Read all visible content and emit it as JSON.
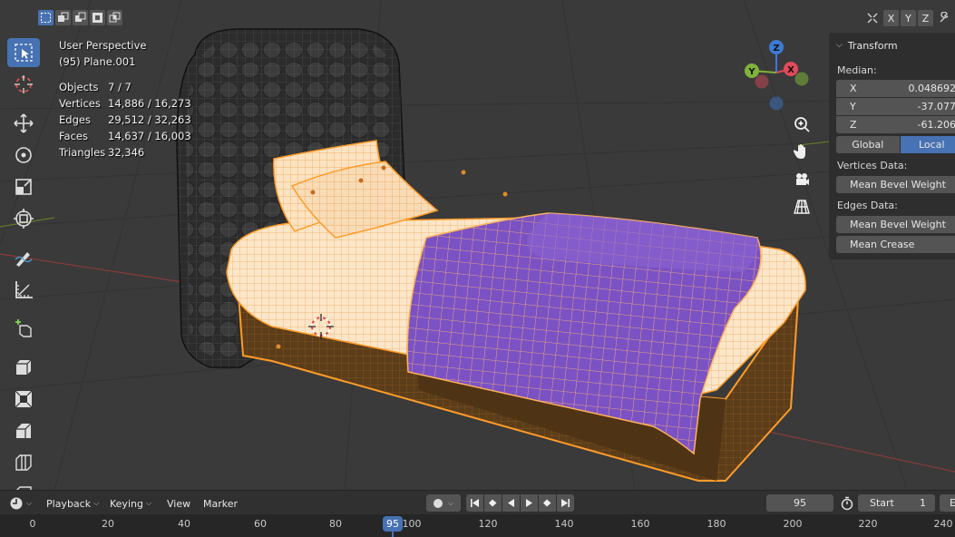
{
  "overlay": {
    "view_name": "User Perspective",
    "object_name": "(95) Plane.001",
    "stats": [
      {
        "label": "Objects",
        "value": "7 / 7"
      },
      {
        "label": "Vertices",
        "value": "14,886 / 16,273"
      },
      {
        "label": "Edges",
        "value": "29,512 / 32,263"
      },
      {
        "label": "Faces",
        "value": "14,637 / 16,003"
      },
      {
        "label": "Triangles",
        "value": "32,346"
      }
    ]
  },
  "header": {
    "mirror_axes": [
      "X",
      "Y",
      "Z"
    ]
  },
  "gizmo": {
    "axes": {
      "x": "X",
      "y": "Y",
      "z": "Z"
    },
    "colors": {
      "x": "#e04a5a",
      "y": "#7fb339",
      "z": "#3d7ad6"
    }
  },
  "npanel": {
    "title": "Transform",
    "median_label": "Median:",
    "median": [
      {
        "axis": "X",
        "value": "0.048692"
      },
      {
        "axis": "Y",
        "value": "-37.077"
      },
      {
        "axis": "Z",
        "value": "-61.206"
      }
    ],
    "space_options": [
      "Global",
      "Local"
    ],
    "space_selected": "Local",
    "vertices_data_label": "Vertices Data:",
    "vertices_btn": "Mean Bevel Weight",
    "edges_data_label": "Edges Data:",
    "edges_btn1": "Mean Bevel Weight",
    "edges_btn2": "Mean Crease"
  },
  "timeline": {
    "menus": [
      "Playback",
      "Keying",
      "View",
      "Marker"
    ],
    "current_frame": "95",
    "start_label": "Start",
    "start_value": "1",
    "end_label": "E",
    "ticks": [
      "0",
      "20",
      "40",
      "60",
      "80",
      "100",
      "120",
      "140",
      "160",
      "180",
      "200",
      "220",
      "240"
    ],
    "marker_frame": "95"
  },
  "colors": {
    "accent": "#4772b3",
    "selection": "#ffa43d",
    "active_select": "#ffb45a"
  }
}
